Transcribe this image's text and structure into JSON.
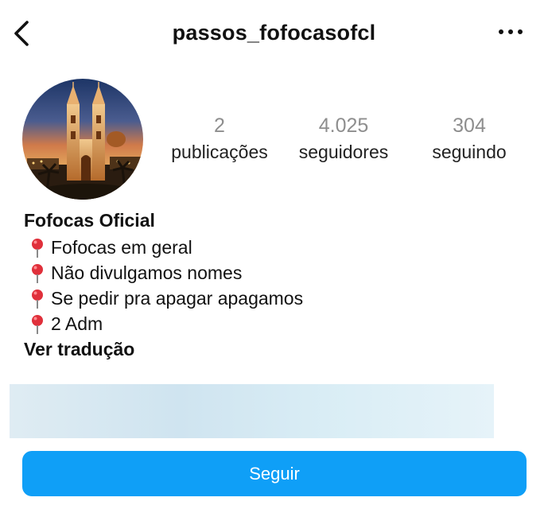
{
  "header": {
    "username": "passos_fofocasofcl",
    "back_icon": "chevron-left-icon",
    "more_icon": "more-horizontal-icon"
  },
  "profile": {
    "avatar": "cathedral-night-photo",
    "stats": [
      {
        "value": "2",
        "label": "publicações"
      },
      {
        "value": "4.025",
        "label": "seguidores"
      },
      {
        "value": "304",
        "label": "seguindo"
      }
    ]
  },
  "bio": {
    "name": "Fofocas Oficial",
    "lines": [
      "Fofocas em geral",
      "Não divulgamos nomes",
      "Se pedir pra apagar apagamos",
      "2 Adm"
    ],
    "line_icon": "pushpin-icon",
    "translate_label": "Ver tradução"
  },
  "actions": {
    "follow_label": "Seguir"
  },
  "colors": {
    "follow_button": "#0f9ff7",
    "stat_number": "#8e8e8e",
    "pin_red": "#e0303b"
  }
}
